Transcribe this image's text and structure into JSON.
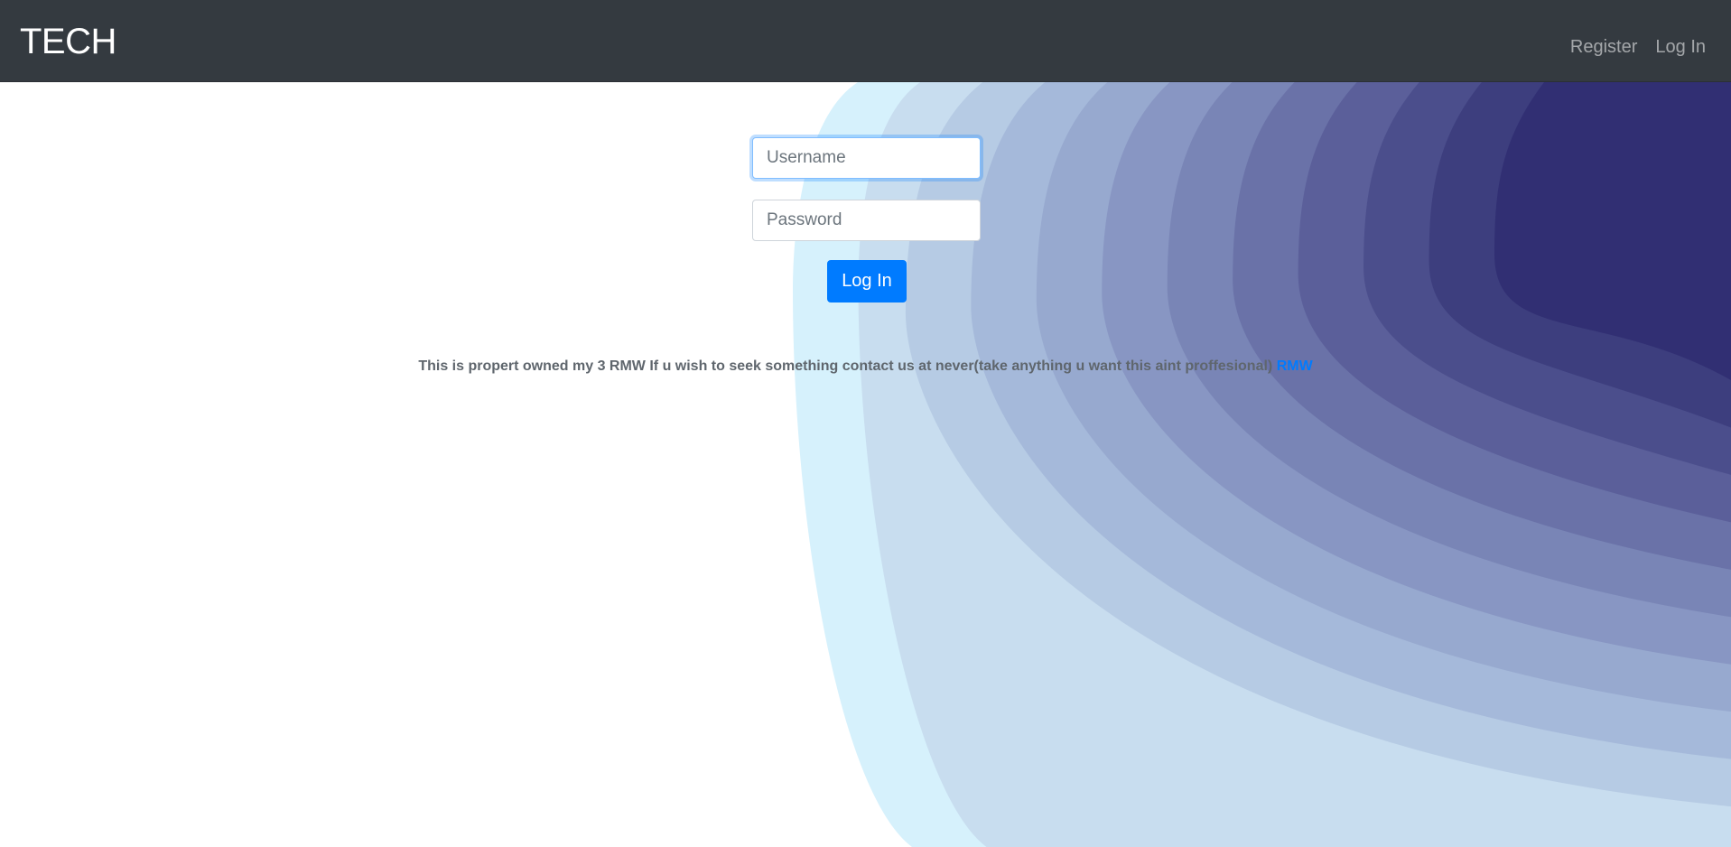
{
  "navbar": {
    "brand": "TECH",
    "links": [
      {
        "label": "Register"
      },
      {
        "label": "Log In"
      }
    ]
  },
  "login_form": {
    "username": {
      "placeholder": "Username",
      "value": ""
    },
    "password": {
      "placeholder": "Password",
      "value": ""
    },
    "submit_label": "Log In"
  },
  "footer": {
    "text": "This is propert owned my 3 RMW If u wish to seek something contact us at never(take anything u want this aint proffesional)",
    "link_label": "RMW"
  },
  "colors": {
    "navbar_bg": "#343a40",
    "primary": "#007bff",
    "wave_palette": [
      "#d6f1fc",
      "#c8ddef",
      "#b6cbe4",
      "#a5b9da",
      "#97a9cf",
      "#8896c3",
      "#7985b6",
      "#6a72a8",
      "#5b5f9a",
      "#4b4e8c",
      "#3d3e7e",
      "#312f73"
    ]
  }
}
